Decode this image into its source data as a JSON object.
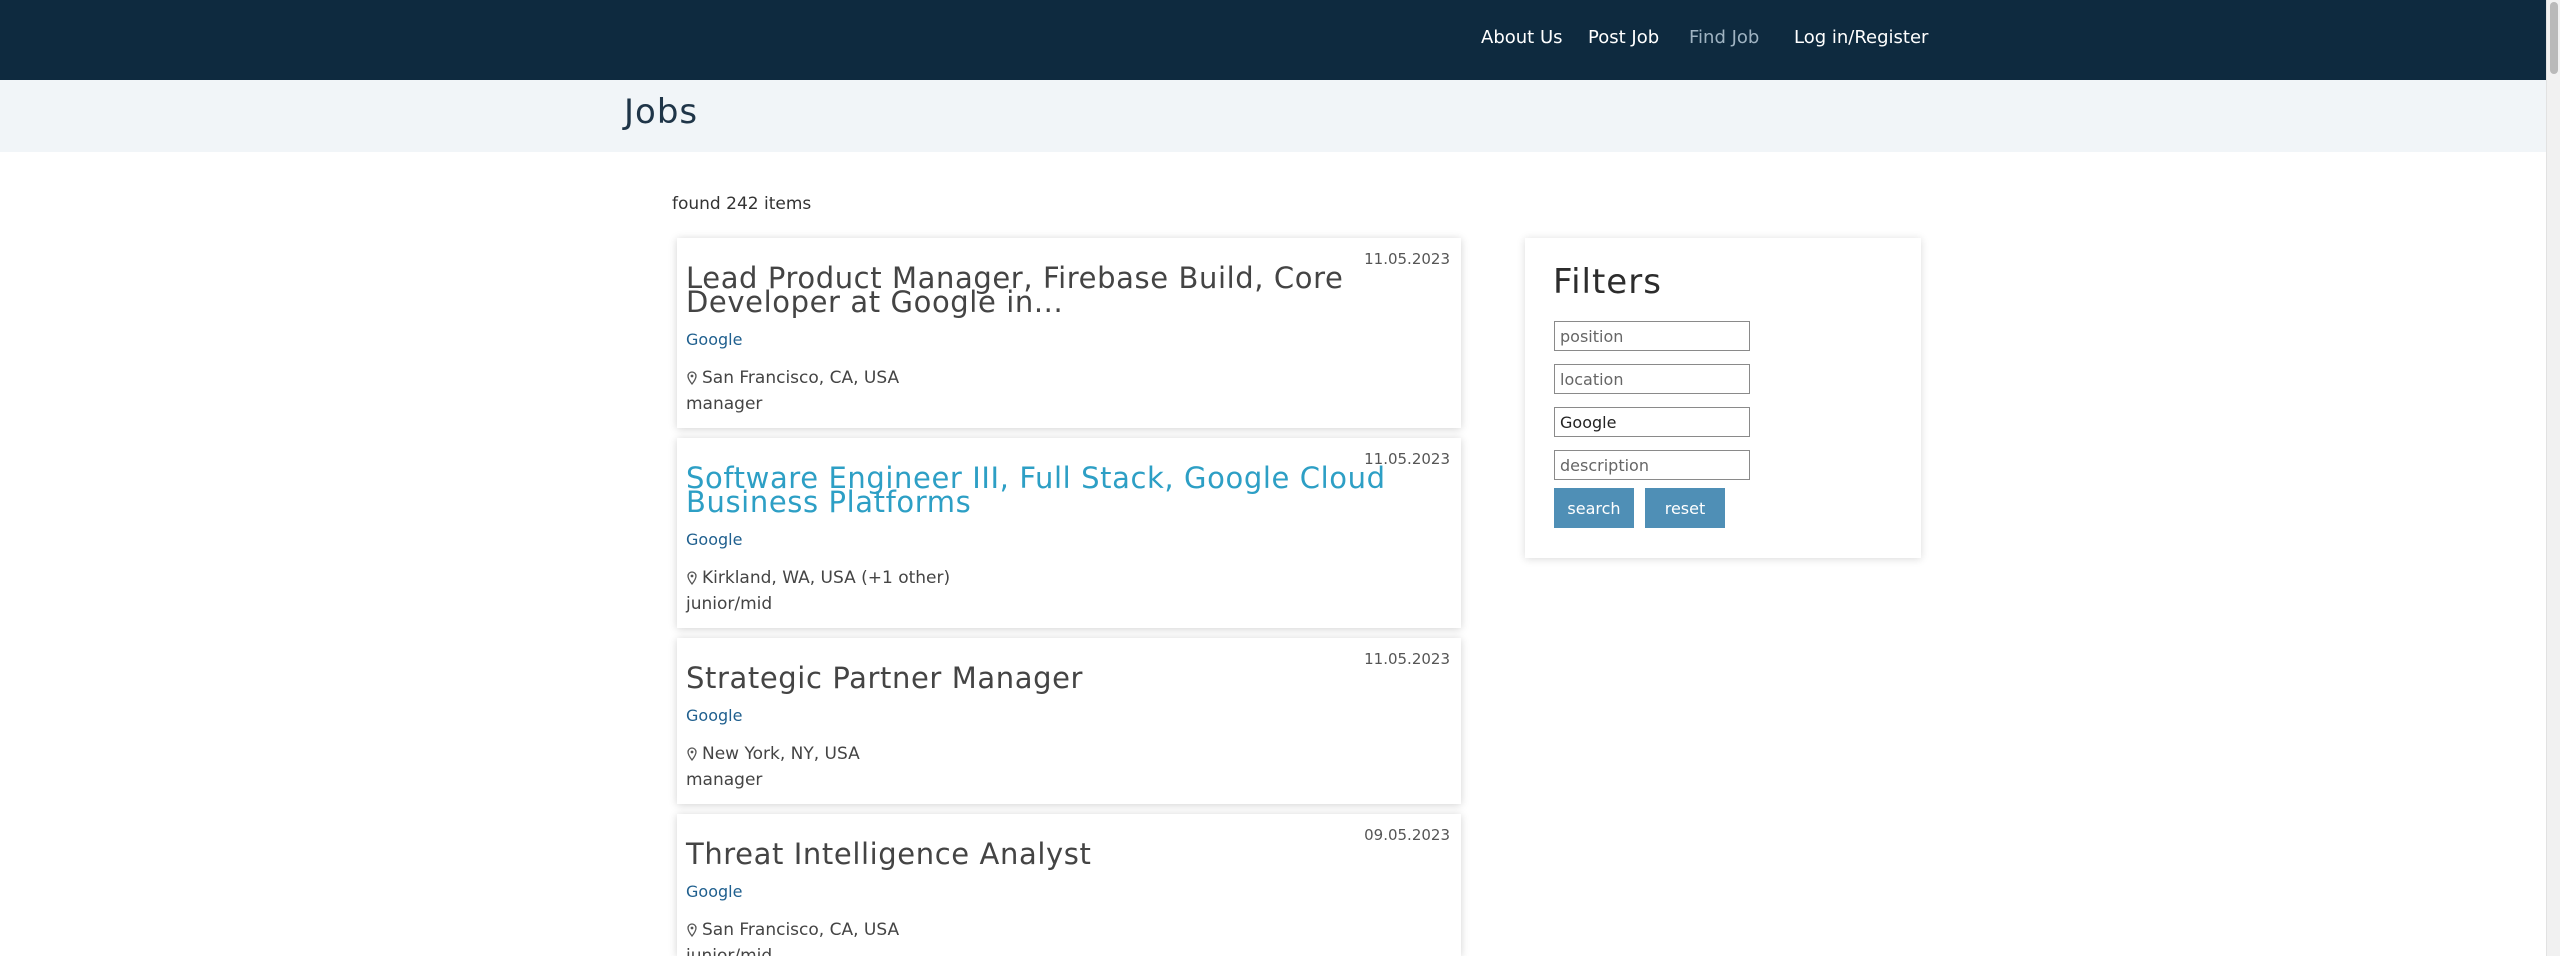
{
  "nav": {
    "links": [
      "About Us",
      "Post Job",
      "Find Job",
      "Log in/Register"
    ]
  },
  "page": {
    "title": "Jobs",
    "found": "found 242 items"
  },
  "jobs": [
    {
      "date": "11.05.2023",
      "title": "Lead Product Manager, Firebase Build, Core Developer at Google in...",
      "company": "Google",
      "location": "San Francisco, CA, USA",
      "level": "manager"
    },
    {
      "date": "11.05.2023",
      "title": "Software Engineer III, Full Stack, Google Cloud Business Platforms",
      "company": "Google",
      "location": "Kirkland, WA, USA (+1 other)",
      "level": "junior/mid"
    },
    {
      "date": "11.05.2023",
      "title": "Strategic Partner Manager",
      "company": "Google",
      "location": "New York, NY, USA",
      "level": "manager"
    },
    {
      "date": "09.05.2023",
      "title": "Threat Intelligence Analyst",
      "company": "Google",
      "location": "San Francisco, CA, USA",
      "level": "junior/mid"
    }
  ],
  "filters": {
    "title": "Filters",
    "position_placeholder": "position",
    "location_placeholder": "location",
    "company_value": "Google",
    "description_placeholder": "description",
    "search_label": "search",
    "reset_label": "reset"
  },
  "colors": {
    "nav_bg": "#0e2a3f",
    "link_title": "#2d9fc5",
    "button": "#4f8fb6"
  },
  "icons": {
    "location": "map-pin-icon"
  }
}
